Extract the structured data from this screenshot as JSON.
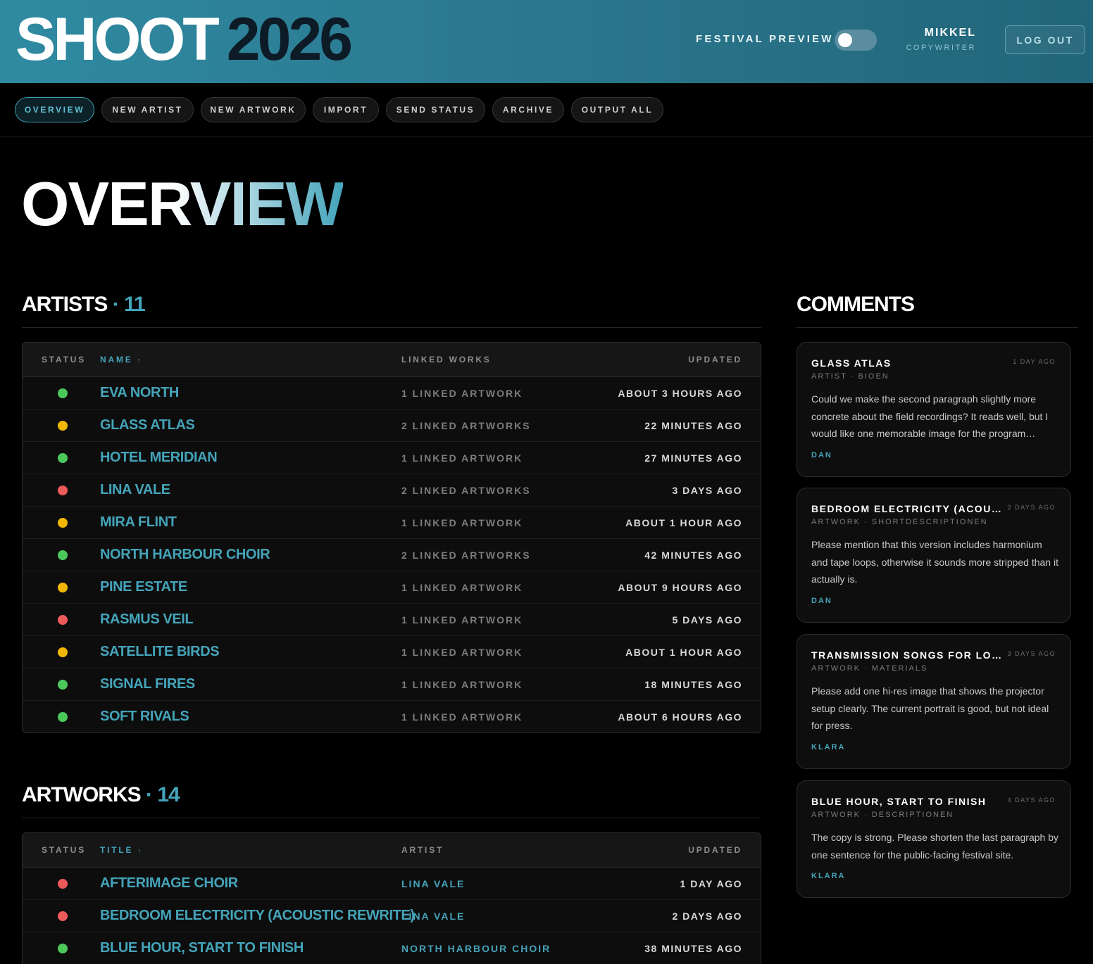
{
  "header": {
    "brand_primary": "SHOOT",
    "brand_secondary": "2026",
    "preview_label": "FESTIVAL PREVIEW",
    "user_name": "MIKKEL",
    "user_role": "COPYWRITER",
    "logout_label": "LOG OUT"
  },
  "nav": {
    "overview": "OVERVIEW",
    "new_artist": "NEW ARTIST",
    "new_artwork": "NEW ARTWORK",
    "import": "IMPORT",
    "send_status": "SEND STATUS",
    "archive": "ARCHIVE",
    "output_all": "OUTPUT ALL"
  },
  "page_title": "OVERVIEW",
  "artists": {
    "heading": "ARTISTS",
    "count_text": " · 11",
    "columns": {
      "status": "STATUS",
      "name": "NAME",
      "sort_indicator": "↑",
      "linked": "LINKED WORKS",
      "updated": "UPDATED"
    },
    "rows": [
      {
        "status": "green",
        "name": "EVA NORTH",
        "linked": "1 LINKED ARTWORK",
        "updated": "ABOUT 3 HOURS AGO"
      },
      {
        "status": "yellow",
        "name": "GLASS ATLAS",
        "linked": "2 LINKED ARTWORKS",
        "updated": "22 MINUTES AGO"
      },
      {
        "status": "green",
        "name": "HOTEL MERIDIAN",
        "linked": "1 LINKED ARTWORK",
        "updated": "27 MINUTES AGO"
      },
      {
        "status": "red",
        "name": "LINA VALE",
        "linked": "2 LINKED ARTWORKS",
        "updated": "3 DAYS AGO"
      },
      {
        "status": "yellow",
        "name": "MIRA FLINT",
        "linked": "1 LINKED ARTWORK",
        "updated": "ABOUT 1 HOUR AGO"
      },
      {
        "status": "green",
        "name": "NORTH HARBOUR CHOIR",
        "linked": "2 LINKED ARTWORKS",
        "updated": "42 MINUTES AGO"
      },
      {
        "status": "yellow",
        "name": "PINE ESTATE",
        "linked": "1 LINKED ARTWORK",
        "updated": "ABOUT 9 HOURS AGO"
      },
      {
        "status": "red",
        "name": "RASMUS VEIL",
        "linked": "1 LINKED ARTWORK",
        "updated": "5 DAYS AGO"
      },
      {
        "status": "yellow",
        "name": "SATELLITE BIRDS",
        "linked": "1 LINKED ARTWORK",
        "updated": "ABOUT 1 HOUR AGO"
      },
      {
        "status": "green",
        "name": "SIGNAL FIRES",
        "linked": "1 LINKED ARTWORK",
        "updated": "18 MINUTES AGO"
      },
      {
        "status": "green",
        "name": "SOFT RIVALS",
        "linked": "1 LINKED ARTWORK",
        "updated": "ABOUT 6 HOURS AGO"
      }
    ]
  },
  "artworks": {
    "heading": "ARTWORKS",
    "count_text": " · 14",
    "columns": {
      "status": "STATUS",
      "title": "TITLE",
      "sort_indicator": "↑",
      "artist": "ARTIST",
      "updated": "UPDATED"
    },
    "rows": [
      {
        "status": "red",
        "title": "AFTERIMAGE CHOIR",
        "artist": "LINA VALE",
        "updated": "1 DAY AGO"
      },
      {
        "status": "red",
        "title": "BEDROOM ELECTRICITY (ACOUSTIC REWRITE)",
        "artist": "LINA VALE",
        "updated": "2 DAYS AGO"
      },
      {
        "status": "green",
        "title": "BLUE HOUR, START TO FINISH",
        "artist": "NORTH HARBOUR CHOIR",
        "updated": "38 MINUTES AGO"
      }
    ]
  },
  "comments": {
    "heading": "COMMENTS",
    "items": [
      {
        "title": "GLASS ATLAS",
        "time": "1 DAY AGO",
        "meta": "ARTIST · BIOEN",
        "body": "Could we make the second paragraph slightly more concrete about the field recordings? It reads well, but I would like one memorable image for the program…",
        "author": "DAN"
      },
      {
        "title": "BEDROOM ELECTRICITY (ACOUSTIC REWRITE)",
        "time": "2 DAYS AGO",
        "meta": "ARTWORK · SHORTDESCRIPTIONEN",
        "body": "Please mention that this version includes harmonium and tape loops, otherwise it sounds more stripped than it actually is.",
        "author": "DAN"
      },
      {
        "title": "TRANSMISSION SONGS FOR LOST RADIOS",
        "time": "3 DAYS AGO",
        "meta": "ARTWORK · MATERIALS",
        "body": "Please add one hi-res image that shows the projector setup clearly. The current portrait is good, but not ideal for press.",
        "author": "KLARA"
      },
      {
        "title": "BLUE HOUR, START TO FINISH",
        "time": "4 DAYS AGO",
        "meta": "ARTWORK · DESCRIPTIONEN",
        "body": "The copy is strong. Please shorten the last paragraph by one sentence for the public-facing festival site.",
        "author": "KLARA"
      }
    ]
  },
  "colors": {
    "accent": "#44a4ba",
    "status_green": "#4cc85b",
    "status_yellow": "#f2b705",
    "status_red": "#ec5a5a"
  }
}
